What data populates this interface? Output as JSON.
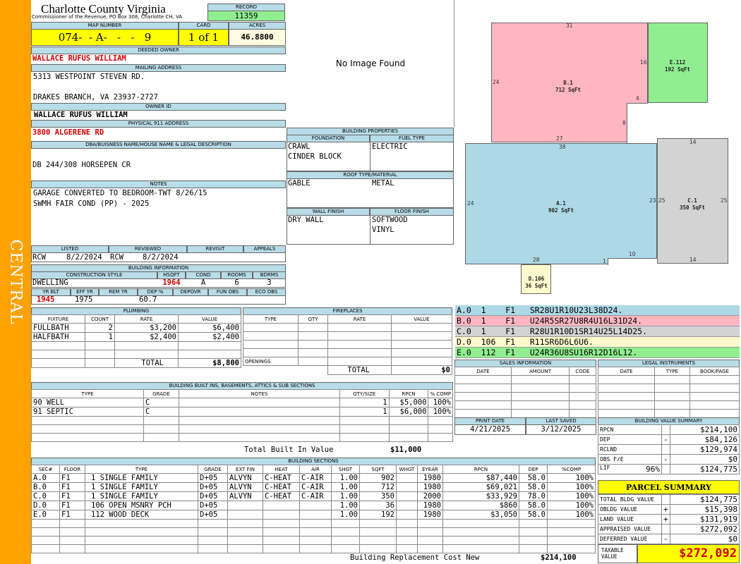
{
  "sidebar": {
    "label": "CENTRAL",
    "color": "#ffa200"
  },
  "header": {
    "county": "Charlotte County Virginia",
    "commissioner": "Commissioner of the Revenue, PO Box 308, Charlotte CH, VA",
    "record_label": "RECORD",
    "record": "11359",
    "map_label": "MAP NUMBER",
    "map_number": "074-  - A-   -   -   9",
    "card_label": "CARD",
    "card": "1 of 1",
    "acres_label": "ACRES",
    "acres": "46.8800"
  },
  "owner": {
    "deeded_label": "DEEDED OWNER",
    "deeded_owner": "WALLACE RUFUS WILLIAM",
    "mailing_label": "MAILING ADDRESS",
    "mail_line1": "5313 WESTPOINT STEVEN RD.",
    "mail_line2": "DRAKES BRANCH, VA 23937-2727",
    "id_label": "OWNER ID",
    "owner_id": "WALLACE RUFUS WILLIAM",
    "physical_label": "PHYSICAL 911 ADDRESS",
    "physical": "3800 ALGERENE RD"
  },
  "legal": {
    "label": "DBA/BUISNESS NAME/HOUSE NAME & LEGAL DESCRIPTION",
    "text": "DB 244/308 HORSEPEN CR"
  },
  "notes": {
    "label": "NOTES",
    "line1": "GARAGE CONVERTED TO BEDROOM-TWT 8/26/15",
    "line2": "SWMH FAIR COND (PP) - 2025"
  },
  "photo": {
    "text": "No Image Found"
  },
  "review": {
    "listed_label": "LISTED",
    "reviewed_label": "REVIEWED",
    "revisit_label": "REVISIT",
    "appeals_label": "APPEALS",
    "listed_by": "RCW",
    "listed_date": "8/2/2024",
    "reviewed_by": "RCW",
    "reviewed_date": "8/2/2024"
  },
  "building_info": {
    "label": "BUILDING INFORMATION",
    "style_label": "CONSTRUCTION STYLE",
    "hsqft_label": "HSQFT",
    "cond_label": "COND",
    "rooms_label": "ROOMS",
    "bdrms_label": "BDRMS",
    "style": "DWELLING",
    "hsqft": "1964",
    "cond": "A",
    "rooms": "6",
    "bdrms": "3",
    "yrblt_label": "YR BLT",
    "effyr_label": "EFF YR",
    "remyr_label": "REM YR",
    "dep_label": "DEP %",
    "depovr_label": "DEPOVR",
    "funobs_label": "FUN OBS",
    "ecoobs_label": "ECO OBS",
    "yrblt": "1945",
    "effyr": "1975",
    "dep": "60.7"
  },
  "properties": {
    "label": "BUILDING PROPERTIES",
    "foundation_label": "FOUNDATION",
    "fuel_label": "FUEL TYPE",
    "foundation1": "CRAWL",
    "foundation2": "CINDER BLOCK",
    "fuel": "ELECTRIC",
    "roof_label": "ROOF TYPE/MATERIAL",
    "roof_type": "GABLE",
    "roof_material": "METAL",
    "wall_label": "WALL FINISH",
    "floor_label": "FLOOR FINISH",
    "wall": "DRY WALL",
    "floor1": "SOFTWOOD",
    "floor2": "VINYL"
  },
  "plumbing": {
    "label": "PLUMBING",
    "cols": [
      "FIXTURE",
      "COUNT",
      "RATE",
      "VALUE"
    ],
    "rows": [
      [
        "FULLBATH",
        "2",
        "$3,200",
        "$6,400"
      ],
      [
        "HALFBATH",
        "1",
        "$2,400",
        "$2,400"
      ]
    ],
    "total_label": "TOTAL",
    "total": "$8,800"
  },
  "fireplaces": {
    "label": "FIREPLACES",
    "cols": [
      "TYPE",
      "QTY",
      "RATE",
      "VALUE"
    ],
    "openings_label": "OPENINGS",
    "total_label": "TOTAL",
    "total": "$0"
  },
  "builtins": {
    "label": "BUILDING BUILT INS, BASEMENTS, ATTICS & SUB SECTIONS",
    "cols": [
      "TYPE",
      "GRADE",
      "NOTES",
      "QTY/SIZE",
      "RPCN",
      "% COMP"
    ],
    "rows": [
      [
        "90 WELL",
        "C",
        "",
        "1",
        "$5,000",
        "100%"
      ],
      [
        "91 SEPTIC",
        "C",
        "",
        "1",
        "$6,000",
        "100%"
      ]
    ],
    "total_label": "Total Built In Value",
    "total": "$11,000"
  },
  "sections": {
    "label": "BUILDING SECTIONS",
    "cols": [
      "SEC#",
      "FLOOR",
      "TYPE",
      "GRADE",
      "EXT FIN",
      "HEAT",
      "AIR",
      "SHGT",
      "SQFT",
      "WHGT",
      "EYEAR",
      "RPCN",
      "DEP",
      "%COMP"
    ],
    "rows": [
      [
        "A.0",
        "F1",
        "1 SINGLE FAMILY",
        "D+05",
        "ALVYN",
        "C-HEAT",
        "C-AIR",
        "1.00",
        "902",
        "",
        "1980",
        "$87,440",
        "58.0",
        "100%"
      ],
      [
        "B.0",
        "F1",
        "1 SINGLE FAMILY",
        "D+05",
        "ALVYN",
        "C-HEAT",
        "C-AIR",
        "1.00",
        "712",
        "",
        "1980",
        "$69,021",
        "58.0",
        "100%"
      ],
      [
        "C.0",
        "F1",
        "1 SINGLE FAMILY",
        "D+05",
        "ALVYN",
        "C-HEAT",
        "C-AIR",
        "1.00",
        "350",
        "",
        "2000",
        "$33,929",
        "78.0",
        "100%"
      ],
      [
        "D.0",
        "F1",
        "106 OPEN MSNRY PCH",
        "D+05",
        "",
        "",
        "",
        "1.00",
        "36",
        "",
        "1980",
        "$860",
        "58.0",
        "100%"
      ],
      [
        "E.0",
        "F1",
        "112 WOOD DECK",
        "D+05",
        "",
        "",
        "",
        "1.00",
        "192",
        "",
        "1980",
        "$3,050",
        "58.0",
        "100%"
      ]
    ],
    "rcn_label": "Building Replacement Cost New",
    "rcn": "$214,100"
  },
  "sketch": {
    "A": {
      "name": "A.1",
      "area": "902 SqFt"
    },
    "B": {
      "name": "B.1",
      "area": "712 SqFt"
    },
    "C": {
      "name": "C.1",
      "area": "350 SqFt"
    },
    "D": {
      "name": "D.106",
      "area": "36 SqFt"
    },
    "E": {
      "name": "E.112",
      "area": "192 SqFt"
    },
    "dims": {
      "d31": "31",
      "d16": "16",
      "d24b": "24",
      "d4": "4",
      "d8": "8",
      "d27": "27",
      "d38": "38",
      "d14t": "14",
      "d24a": "24",
      "d23": "23",
      "d25l": "25",
      "d25r": "25",
      "d10": "10",
      "d28": "28",
      "d1": "1",
      "d14b": "14"
    },
    "colors": {
      "A": "#add8e6",
      "B": "#ffb6c1",
      "C": "#d3d3d3",
      "D": "#fffacd",
      "E": "#90ee90"
    },
    "segments": [
      {
        "text": "A.0  1    F1   SR28U1R10U23L38D24.",
        "color": "#add8e6"
      },
      {
        "text": "B.0  1    F1   U24R5SR27U8R4U16L31D24.",
        "color": "#ffb6c1"
      },
      {
        "text": "C.0  1    F1   R28U1R10D1SR14U25L14D25.",
        "color": "#d3d3d3"
      },
      {
        "text": "D.0  106  F1   R11SR6D6L6U6.",
        "color": "#fffacd"
      },
      {
        "text": "E.0  112  F1   U24R36U8SU16R12D16L12.",
        "color": "#90ee90"
      }
    ]
  },
  "sales": {
    "label": "SALES INFORMATION",
    "cols": [
      "DATE",
      "AMOUNT",
      "CODE"
    ]
  },
  "legal_instr": {
    "label": "LEGAL INSTRUMENTS",
    "cols": [
      "DATE",
      "TYPE",
      "BOOK/PAGE"
    ]
  },
  "dates": {
    "print_label": "PRINT DATE",
    "print": "4/21/2025",
    "saved_label": "LAST SAVED",
    "saved": "3/12/2025"
  },
  "value_summary": {
    "label": "BUILDING VALUE SUMMARY",
    "rows": [
      {
        "k": "RPCN",
        "s": "",
        "v": "$214,100"
      },
      {
        "k": "DEP",
        "s": "-",
        "v": "$84,126"
      },
      {
        "k": "RCLND",
        "s": "",
        "v": "$129,974"
      },
      {
        "k": "OBS F/E",
        "s": "-",
        "v": "$0"
      },
      {
        "k": "LIF",
        "pct": "96%",
        "s": "",
        "v": "$124,775"
      }
    ]
  },
  "parcel": {
    "label": "PARCEL SUMMARY",
    "rows": [
      {
        "k": "TOTAL BLDG VALUE",
        "s": "",
        "v": "$124,775"
      },
      {
        "k": "OBLDG VALUE",
        "s": "+",
        "v": "$15,398"
      },
      {
        "k": "LAND VALUE",
        "s": "+",
        "v": "$131,919"
      },
      {
        "k": "APPRAISED VALUE",
        "s": "",
        "v": "$272,092"
      },
      {
        "k": "DEFERRED VALUE",
        "s": "-",
        "v": "$0"
      }
    ],
    "taxable_label": "TAXABLE VALUE",
    "taxable": "$272,092"
  }
}
